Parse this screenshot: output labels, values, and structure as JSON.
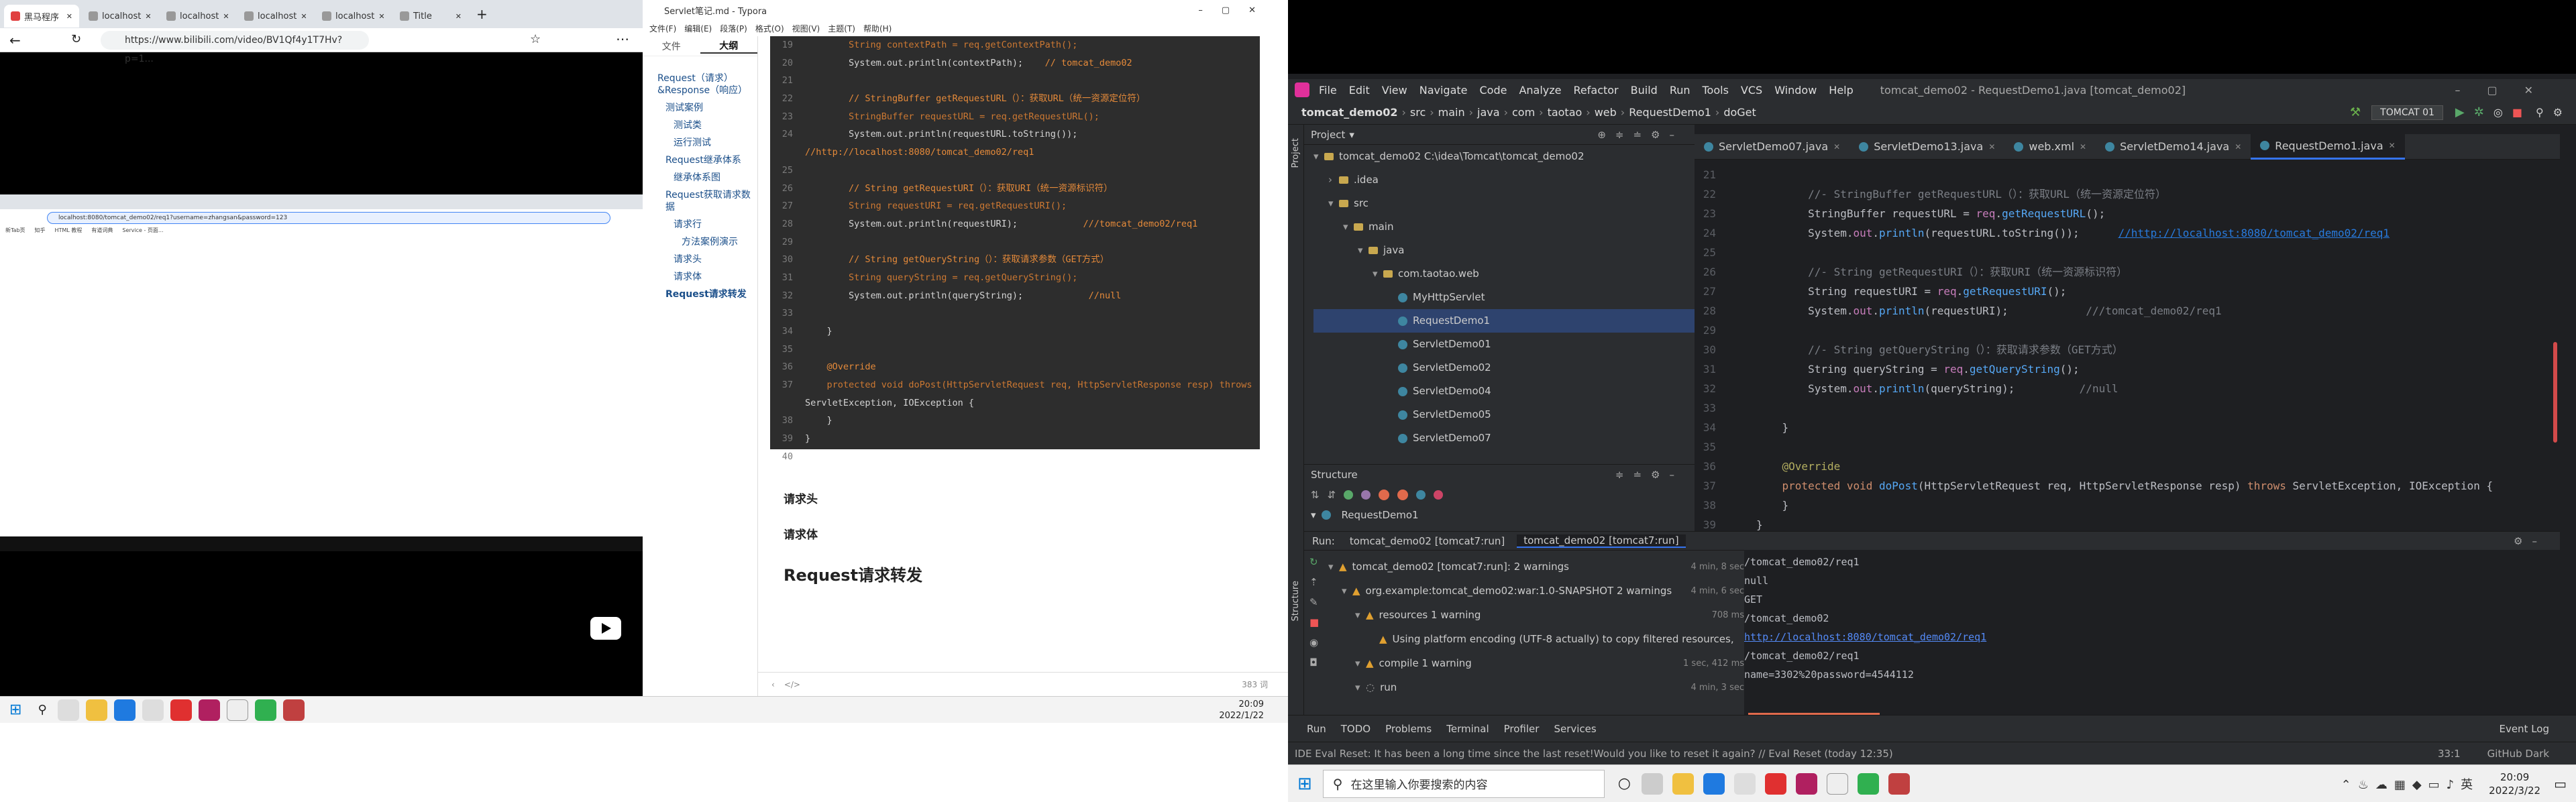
{
  "browser": {
    "tabs": [
      {
        "label": "黑马程序",
        "color": "#e04040"
      },
      {
        "label": "localhost",
        "color": "#999"
      },
      {
        "label": "localhost",
        "color": "#999"
      },
      {
        "label": "localhost",
        "color": "#999"
      },
      {
        "label": "localhost",
        "color": "#999"
      },
      {
        "label": "Title",
        "color": "#999"
      }
    ],
    "address": "https://www.bilibili.com/video/BV1Qf4y1T7Hv?p=1...",
    "inner_address": "localhost:8080/tomcat_demo02/req1?username=zhangsan&password=123",
    "inner_bookmarks": [
      "新Tab页",
      "知乎",
      "HTML 教程",
      "有道词典",
      "Service - 页面..."
    ]
  },
  "left_taskbar": {
    "time": "20:09",
    "date": "2022/1/22"
  },
  "typora": {
    "title": "Servlet笔记.md - Typora",
    "menu": [
      "文件(F)",
      "编辑(E)",
      "段落(P)",
      "格式(O)",
      "视图(V)",
      "主题(T)",
      "帮助(H)"
    ],
    "side_tabs": {
      "files": "文件",
      "outline": "大纲"
    },
    "outline": [
      {
        "text": "Request（请求）&Response（响应）",
        "indent": 0
      },
      {
        "text": "测试案例",
        "indent": 1
      },
      {
        "text": "测试类",
        "indent": 2
      },
      {
        "text": "运行测试",
        "indent": 2
      },
      {
        "text": "Request继承体系",
        "indent": 1
      },
      {
        "text": "继承体系图",
        "indent": 2
      },
      {
        "text": "Request获取请求数据",
        "indent": 1
      },
      {
        "text": "请求行",
        "indent": 2
      },
      {
        "text": "方法案例演示",
        "indent": 3
      },
      {
        "text": "请求头",
        "indent": 2
      },
      {
        "text": "请求体",
        "indent": 2
      },
      {
        "text": "Request请求转发",
        "indent": 1
      }
    ],
    "code_lines": [
      {
        "n": "19",
        "code": "        String contextPath = req.getContextPath();",
        "comment": ""
      },
      {
        "n": "20",
        "code": "        System.out.println(contextPath);",
        "comment": "    // tomcat_demo02"
      },
      {
        "n": "21",
        "code": "",
        "comment": ""
      },
      {
        "n": "22",
        "code": "",
        "comment": "        // StringBuffer getRequestURL（）：获取URL（统一资源定位符）"
      },
      {
        "n": "23",
        "code": "        StringBuffer requestURL = req.getRequestURL();",
        "comment": ""
      },
      {
        "n": "24",
        "code": "        System.out.println(requestURL.toString());",
        "comment": ""
      },
      {
        "n": "",
        "code": "",
        "comment": "//http://localhost:8080/tomcat_demo02/req1"
      },
      {
        "n": "25",
        "code": "",
        "comment": ""
      },
      {
        "n": "26",
        "code": "",
        "comment": "        // String getRequestURI（）：获取URI（统一资源标识符）"
      },
      {
        "n": "27",
        "code": "        String requestURI = req.getRequestURI();",
        "comment": ""
      },
      {
        "n": "28",
        "code": "        System.out.println(requestURI);",
        "comment": "            ///tomcat_demo02/req1"
      },
      {
        "n": "29",
        "code": "",
        "comment": ""
      },
      {
        "n": "30",
        "code": "",
        "comment": "        // String getQueryString（）：获取请求参数（GET方式）"
      },
      {
        "n": "31",
        "code": "        String queryString = req.getQueryString();",
        "comment": ""
      },
      {
        "n": "32",
        "code": "        System.out.println(queryString);",
        "comment": "            //null"
      },
      {
        "n": "33",
        "code": "",
        "comment": ""
      },
      {
        "n": "34",
        "code": "    }",
        "comment": ""
      },
      {
        "n": "35",
        "code": "",
        "comment": ""
      },
      {
        "n": "36",
        "code": "    @Override",
        "comment": ""
      },
      {
        "n": "37",
        "code": "    protected void doPost(HttpServletRequest req, HttpServletResponse resp) throws",
        "comment": ""
      },
      {
        "n": "",
        "code": "ServletException, IOException {",
        "comment": ""
      },
      {
        "n": "38",
        "code": "    }",
        "comment": ""
      },
      {
        "n": "39",
        "code": "}",
        "comment": ""
      },
      {
        "n": "40",
        "code": "",
        "comment": ""
      }
    ],
    "headings": [
      "请求头",
      "请求体",
      "Request请求转发"
    ],
    "word_count": "383 词",
    "bottom_left": "<"
  },
  "idea": {
    "menu": [
      "File",
      "Edit",
      "View",
      "Navigate",
      "Code",
      "Analyze",
      "Refactor",
      "Build",
      "Run",
      "Tools",
      "VCS",
      "Window",
      "Help"
    ],
    "window_title": "tomcat_demo02 - RequestDemo1.java [tomcat_demo02]",
    "breadcrumb": [
      "tomcat_demo02",
      "src",
      "main",
      "java",
      "com",
      "taotao",
      "web",
      "RequestDemo1",
      "doGet"
    ],
    "run_config": "TOMCAT 01",
    "project_label": "Project",
    "tree": [
      {
        "label": "tomcat_demo02  C:\\idea\\Tomcat\\tomcat_demo02",
        "indent": 0,
        "kind": "folder",
        "open": true
      },
      {
        "label": ".idea",
        "indent": 1,
        "kind": "folder",
        "open": false
      },
      {
        "label": "src",
        "indent": 1,
        "kind": "folder",
        "open": true
      },
      {
        "label": "main",
        "indent": 2,
        "kind": "folder",
        "open": true
      },
      {
        "label": "java",
        "indent": 3,
        "kind": "folder",
        "open": true
      },
      {
        "label": "com.taotao.web",
        "indent": 4,
        "kind": "folder",
        "open": true
      },
      {
        "label": "MyHttpServlet",
        "indent": 5,
        "kind": "class",
        "selected": false
      },
      {
        "label": "RequestDemo1",
        "indent": 5,
        "kind": "class",
        "selected": true
      },
      {
        "label": "ServletDemo01",
        "indent": 5,
        "kind": "class",
        "selected": false
      },
      {
        "label": "ServletDemo02",
        "indent": 5,
        "kind": "class",
        "selected": false
      },
      {
        "label": "ServletDemo04",
        "indent": 5,
        "kind": "class",
        "selected": false
      },
      {
        "label": "ServletDemo05",
        "indent": 5,
        "kind": "class",
        "selected": false
      },
      {
        "label": "ServletDemo07",
        "indent": 5,
        "kind": "class",
        "selected": false
      }
    ],
    "structure_label": "Structure",
    "structure_item": "RequestDemo1",
    "editor_tabs": [
      {
        "label": "ServletDemo07.java",
        "active": false
      },
      {
        "label": "ServletDemo13.java",
        "active": false
      },
      {
        "label": "web.xml",
        "active": false
      },
      {
        "label": "ServletDemo14.java",
        "active": false
      },
      {
        "label": "RequestDemo1.java",
        "active": true
      }
    ],
    "editor_lines": [
      {
        "n": "21",
        "parts": []
      },
      {
        "n": "22",
        "parts": [
          [
            "ecm",
            "        //- StringBuffer getRequestURL（）：获取URL（统一资源定位符）"
          ]
        ]
      },
      {
        "n": "23",
        "parts": [
          [
            "et",
            "        StringBuffer "
          ],
          [
            "et",
            "requestURL = "
          ],
          [
            "ev",
            "req"
          ],
          [
            "et",
            "."
          ],
          [
            "em",
            "getRequestURL"
          ],
          [
            "et",
            "();"
          ]
        ]
      },
      {
        "n": "24",
        "parts": [
          [
            "et",
            "        System."
          ],
          [
            "ev",
            "out"
          ],
          [
            "et",
            "."
          ],
          [
            "em",
            "println"
          ],
          [
            "et",
            "(requestURL.toString());      "
          ],
          [
            "elk",
            "//http://localhost:8080/tomcat_demo02/req1"
          ]
        ]
      },
      {
        "n": "25",
        "parts": []
      },
      {
        "n": "26",
        "parts": [
          [
            "ecm",
            "        //- String getRequestURI（）：获取URI（统一资源标识符）"
          ]
        ]
      },
      {
        "n": "27",
        "parts": [
          [
            "et",
            "        String "
          ],
          [
            "et",
            "requestURI = "
          ],
          [
            "ev",
            "req"
          ],
          [
            "et",
            "."
          ],
          [
            "em",
            "getRequestURI"
          ],
          [
            "et",
            "();"
          ]
        ]
      },
      {
        "n": "28",
        "parts": [
          [
            "et",
            "        System."
          ],
          [
            "ev",
            "out"
          ],
          [
            "et",
            "."
          ],
          [
            "em",
            "println"
          ],
          [
            "et",
            "(requestURI);            "
          ],
          [
            "ecm",
            "///tomcat_demo02/req1"
          ]
        ]
      },
      {
        "n": "29",
        "parts": []
      },
      {
        "n": "30",
        "parts": [
          [
            "ecm",
            "        //- String getQueryString（）：获取请求参数（GET方式）"
          ]
        ]
      },
      {
        "n": "31",
        "parts": [
          [
            "et",
            "        String "
          ],
          [
            "et",
            "queryString = "
          ],
          [
            "ev",
            "req"
          ],
          [
            "et",
            "."
          ],
          [
            "em",
            "getQueryString"
          ],
          [
            "et",
            "();"
          ]
        ]
      },
      {
        "n": "32",
        "parts": [
          [
            "et",
            "        System."
          ],
          [
            "ev",
            "out"
          ],
          [
            "et",
            "."
          ],
          [
            "em",
            "println"
          ],
          [
            "et",
            "(queryString);          "
          ],
          [
            "ecm",
            "//null"
          ]
        ]
      },
      {
        "n": "33",
        "parts": []
      },
      {
        "n": "34",
        "parts": [
          [
            "et",
            "    }"
          ]
        ]
      },
      {
        "n": "35",
        "parts": []
      },
      {
        "n": "36",
        "parts": [
          [
            "ean",
            "    @Override"
          ]
        ]
      },
      {
        "n": "37",
        "parts": [
          [
            "ek",
            "    protected void "
          ],
          [
            "em",
            "doPost"
          ],
          [
            "et",
            "(HttpServletRequest req, HttpServletResponse resp) "
          ],
          [
            "ek",
            "throws "
          ],
          [
            "et",
            "ServletException, IOException {"
          ]
        ]
      },
      {
        "n": "38",
        "parts": [
          [
            "et",
            "    }"
          ]
        ]
      },
      {
        "n": "39",
        "parts": [
          [
            "et",
            "}"
          ]
        ]
      }
    ],
    "run": {
      "label": "Run:",
      "tabs": [
        "tomcat_demo02 [tomcat7:run]",
        "tomcat_demo02 [tomcat7:run]"
      ],
      "tree": [
        {
          "text": "tomcat_demo02 [tomcat7:run]:  2 warnings",
          "time": "4 min, 8 sec",
          "indent": 0
        },
        {
          "text": "org.example:tomcat_demo02:war:1.0-SNAPSHOT  2 warnings",
          "time": "4 min, 6 sec",
          "indent": 1
        },
        {
          "text": "resources  1 warning",
          "time": "708 ms",
          "indent": 2
        },
        {
          "text": "Using platform encoding (UTF-8 actually) to copy filtered resources,",
          "time": "",
          "indent": 3
        },
        {
          "text": "compile  1 warning",
          "time": "1 sec, 412 ms",
          "indent": 2
        },
        {
          "text": "run",
          "time": "4 min, 3 sec",
          "indent": 2
        }
      ],
      "console": [
        {
          "text": "/tomcat_demo02/req1",
          "link": false
        },
        {
          "text": "null",
          "link": false
        },
        {
          "text": "GET",
          "link": false
        },
        {
          "text": "/tomcat_demo02",
          "link": false
        },
        {
          "text": "http://localhost:8080/tomcat_demo02/req1",
          "link": true
        },
        {
          "text": "/tomcat_demo02/req1",
          "link": false
        },
        {
          "text": "name=3302%20password=4544112",
          "link": false
        }
      ]
    },
    "bottom_tools": [
      "Run",
      "TODO",
      "Problems",
      "Terminal",
      "Profiler",
      "Services"
    ],
    "event_log": "Event Log",
    "status_msg": "IDE Eval Reset: It has been a long time since the last reset!Would you like to reset it again? // Eval Reset (today 12:35)",
    "status_pos": "33:1",
    "status_theme": "GitHub Dark"
  },
  "right_taskbar": {
    "search_placeholder": "在这里输入你要搜索的内容",
    "time": "20:09",
    "date": "2022/3/22"
  }
}
